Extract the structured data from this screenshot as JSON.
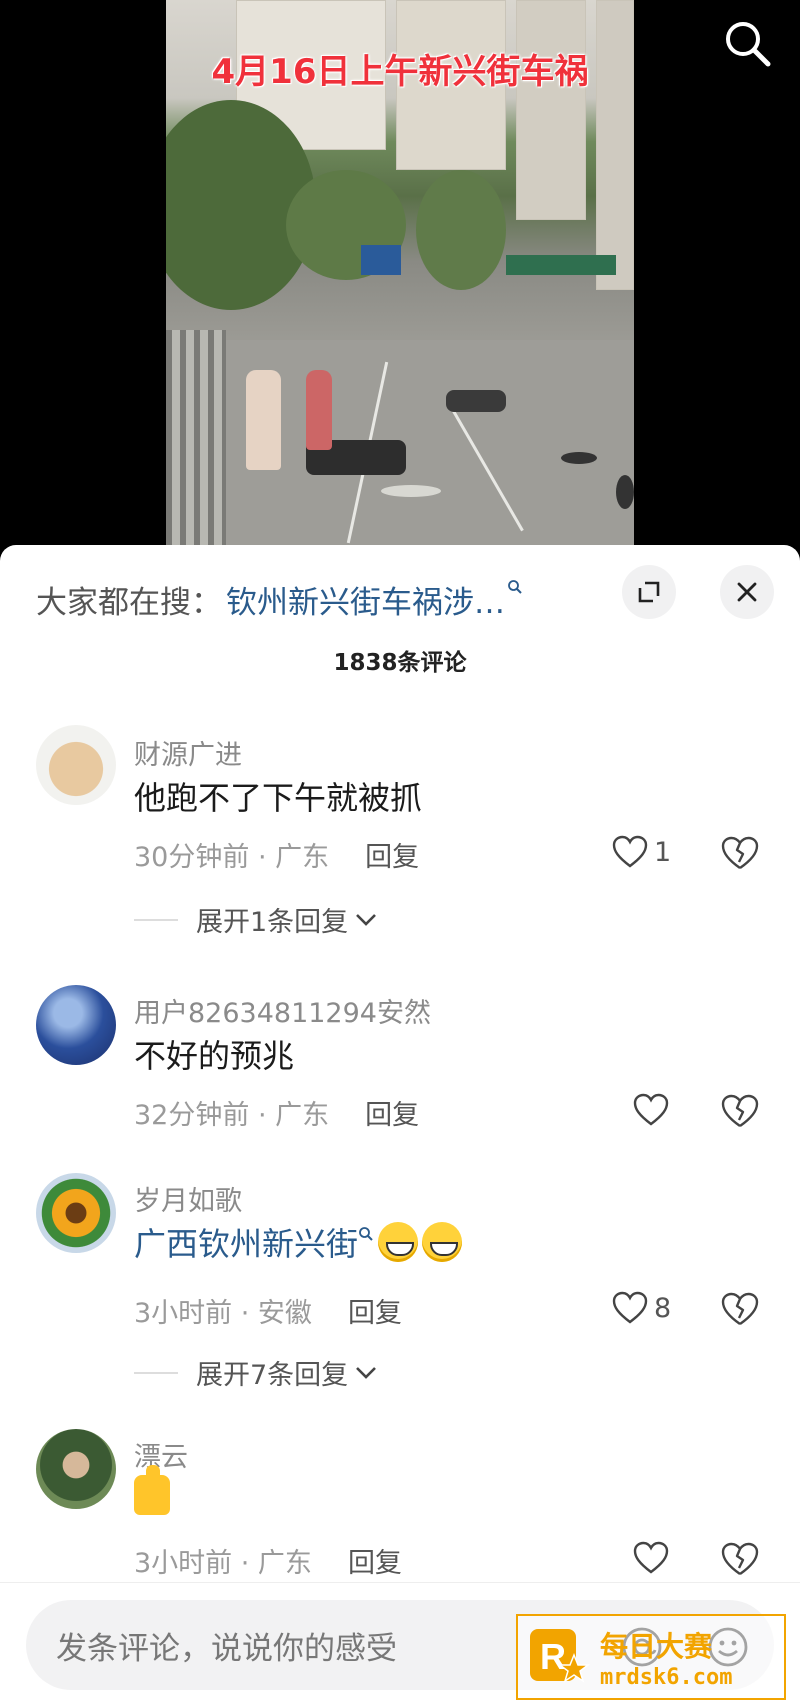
{
  "video": {
    "caption": "4月16日上午新兴街车祸",
    "search_icon": "search-icon"
  },
  "sheet": {
    "search_prefix": "大家都在搜：",
    "search_term": "钦州新兴街车祸涉…",
    "search_q_icon": "search-small-icon",
    "expand_icon": "expand-icon",
    "close_icon": "close-icon",
    "comment_count": "1838条评论"
  },
  "comments": [
    {
      "username": "财源广进",
      "text": "他跑不了下午就被抓",
      "time_location": "30分钟前 · 广东",
      "reply_label": "回复",
      "likes": "1",
      "expand_replies": "展开1条回复"
    },
    {
      "username": "用户82634811294安然",
      "text": "不好的预兆",
      "time_location": "32分钟前 · 广东",
      "reply_label": "回复",
      "likes": ""
    },
    {
      "username": "岁月如歌",
      "text": "广西钦州新兴街",
      "time_location": "3小时前 · 安徽",
      "reply_label": "回复",
      "likes": "8",
      "expand_replies": "展开7条回复"
    },
    {
      "username": "漂云",
      "text": "",
      "time_location": "3小时前 · 广东",
      "reply_label": "回复",
      "likes": ""
    }
  ],
  "input": {
    "placeholder": "发条评论，说说你的感受",
    "at_icon": "at-icon",
    "emoji_icon": "smile-icon"
  },
  "watermark": {
    "title": "每日大赛",
    "url": "mrdsk6.com"
  },
  "colors": {
    "link": "#2a5b8c",
    "caption": "#f0313b",
    "watermark": "#f2a400"
  }
}
